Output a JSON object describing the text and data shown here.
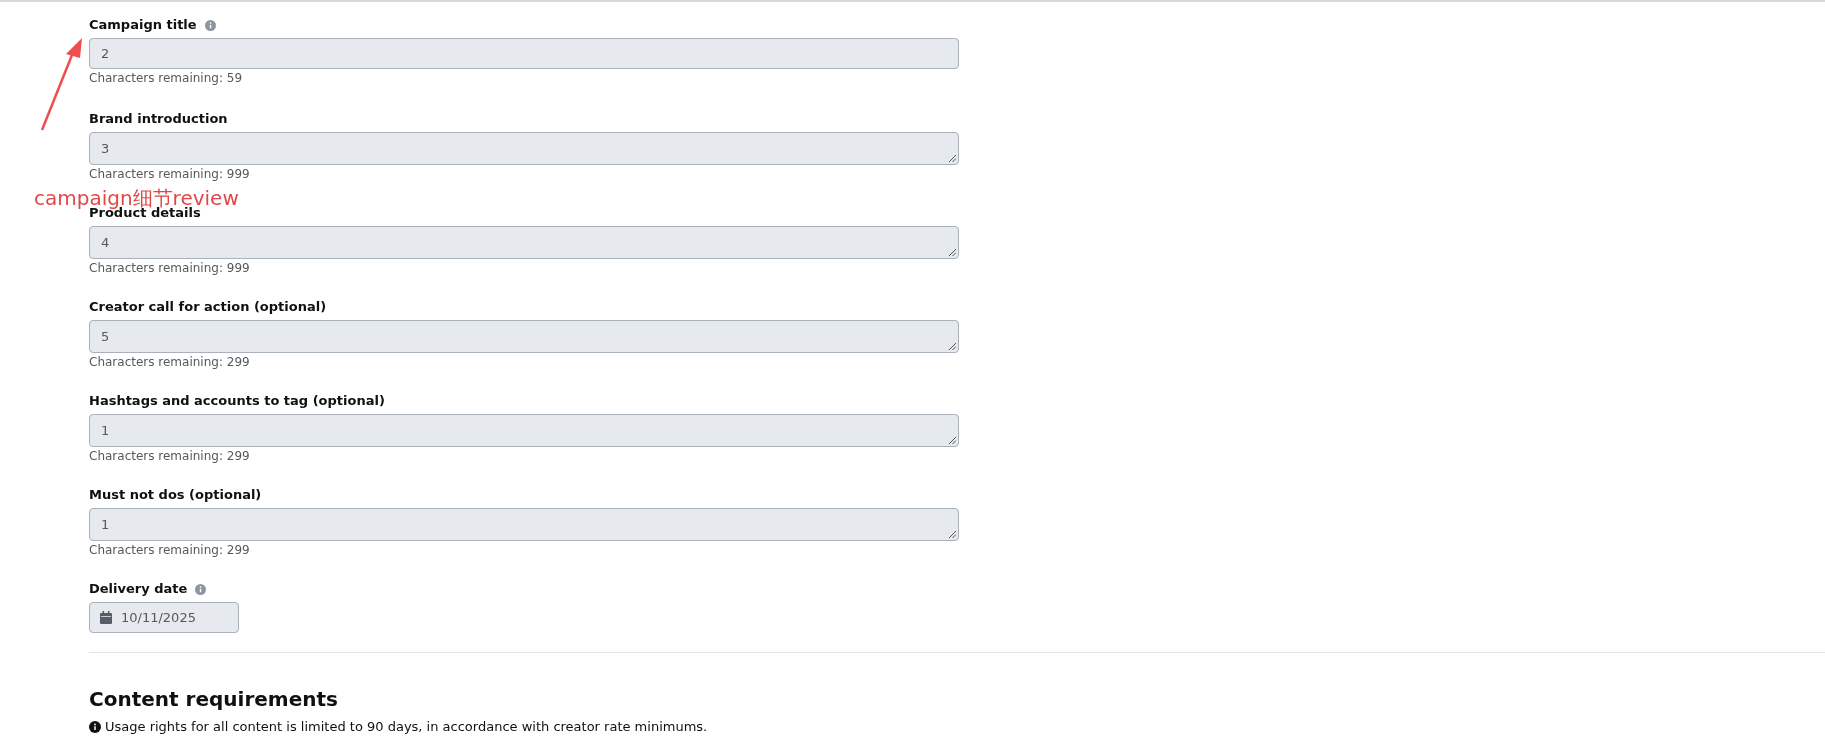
{
  "annotation": {
    "text": "campaign细节review"
  },
  "fields": [
    {
      "kind": "input",
      "label": "Campaign title",
      "info": true,
      "value": "2",
      "helper": "Characters remaining: 59"
    },
    {
      "kind": "textarea",
      "label": "Brand introduction",
      "info": false,
      "value": "3",
      "helper": "Characters remaining: 999"
    },
    {
      "kind": "textarea",
      "label": "Product details",
      "info": false,
      "value": "4",
      "helper": "Characters remaining: 999"
    },
    {
      "kind": "textarea",
      "label": "Creator call for action (optional)",
      "info": false,
      "value": "5",
      "helper": "Characters remaining: 299"
    },
    {
      "kind": "textarea",
      "label": "Hashtags and accounts to tag (optional)",
      "info": false,
      "value": "1",
      "helper": "Characters remaining: 299"
    },
    {
      "kind": "textarea",
      "label": "Must not dos (optional)",
      "info": false,
      "value": "1",
      "helper": "Characters remaining: 299"
    },
    {
      "kind": "date",
      "label": "Delivery date",
      "info": true,
      "value": "10/11/2025"
    }
  ],
  "content_requirements": {
    "title": "Content requirements",
    "note": "Usage rights for all content is limited to 90 days, in accordance with creator rate minimums."
  }
}
